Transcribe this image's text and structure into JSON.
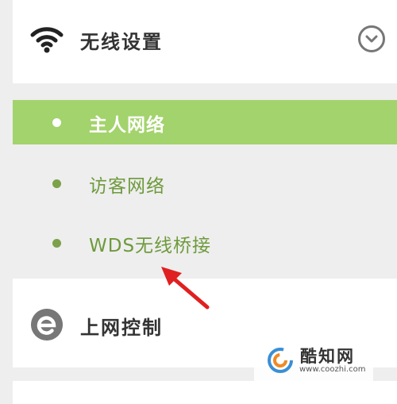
{
  "wireless_card": {
    "title": "无线设置",
    "icon": "wifi-icon",
    "toggle_icon": "chevron-down-icon"
  },
  "submenu": {
    "items": [
      {
        "label": "主人网络",
        "active": true
      },
      {
        "label": "访客网络",
        "active": false
      },
      {
        "label": "WDS无线桥接",
        "active": false
      }
    ]
  },
  "net_control_card": {
    "title": "上网控制",
    "icon": "e-icon"
  },
  "annotation": {
    "arrow_color": "#e02020"
  },
  "watermark": {
    "name": "酷知网",
    "url": "www.coozhi.com"
  },
  "colors": {
    "active_bg": "#a3d36c",
    "item_text": "#6e9a3c",
    "bullet": "#7ba14a"
  }
}
